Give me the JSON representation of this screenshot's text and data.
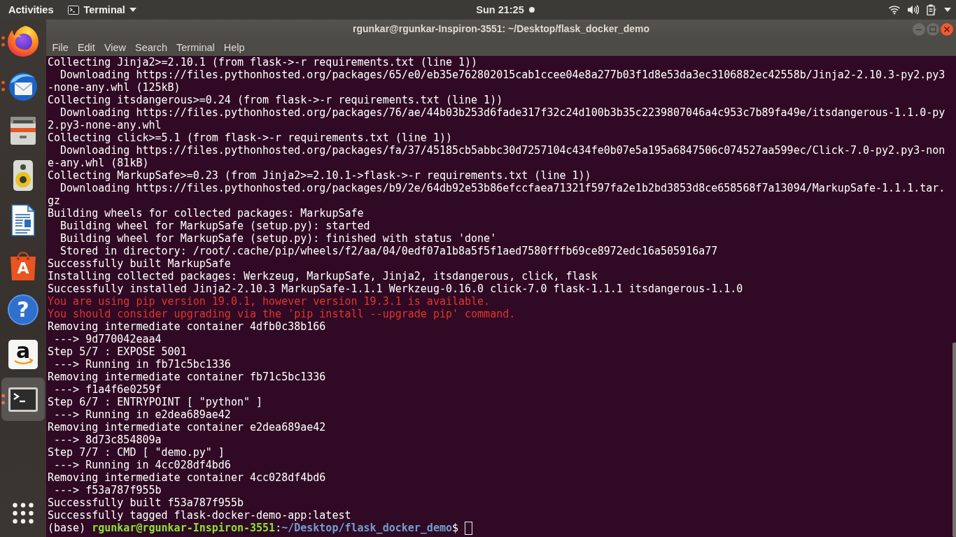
{
  "top_bar": {
    "activities": "Activities",
    "app_menu": "Terminal",
    "clock": "Sun 21:25",
    "notification": true
  },
  "dock": {
    "items": [
      {
        "kind": "browser",
        "running": true,
        "selected": false
      },
      {
        "kind": "mail",
        "running": true,
        "selected": false
      },
      {
        "kind": "files",
        "running": false,
        "selected": false
      },
      {
        "kind": "music",
        "running": false,
        "selected": false
      },
      {
        "kind": "writer",
        "running": false,
        "selected": false
      },
      {
        "kind": "software",
        "glyph": "A",
        "running": false,
        "selected": false
      },
      {
        "kind": "help",
        "glyph": "?",
        "running": false,
        "selected": false
      },
      {
        "kind": "store",
        "glyph": "a",
        "running": false,
        "selected": false
      },
      {
        "kind": "terminal",
        "running": true,
        "selected": true
      }
    ]
  },
  "window": {
    "title": "rgunkar@rgunkar-Inspiron-3551: ~/Desktop/flask_docker_demo",
    "menu": [
      "File",
      "Edit",
      "View",
      "Search",
      "Terminal",
      "Help"
    ]
  },
  "terminal": {
    "cursor_focused": false,
    "lines": [
      {
        "kind": "output",
        "text": "Collecting Jinja2>=2.10.1 (from flask->-r requirements.txt (line 1))"
      },
      {
        "kind": "output",
        "text": "  Downloading https://files.pythonhosted.org/packages/65/e0/eb35e762802015cab1ccee04e8a277b03f1d8e53da3ec3106882ec42558b/Jinja2-2.10.3-py2.py3-none-any.whl (125kB)"
      },
      {
        "kind": "output",
        "text": "Collecting itsdangerous>=0.24 (from flask->-r requirements.txt (line 1))"
      },
      {
        "kind": "output",
        "text": "  Downloading https://files.pythonhosted.org/packages/76/ae/44b03b253d6fade317f32c24d100b3b35c2239807046a4c953c7b89fa49e/itsdangerous-1.1.0-py2.py3-none-any.whl"
      },
      {
        "kind": "output",
        "text": "Collecting click>=5.1 (from flask->-r requirements.txt (line 1))"
      },
      {
        "kind": "output",
        "text": "  Downloading https://files.pythonhosted.org/packages/fa/37/45185cb5abbc30d7257104c434fe0b07e5a195a6847506c074527aa599ec/Click-7.0-py2.py3-none-any.whl (81kB)"
      },
      {
        "kind": "output",
        "text": "Collecting MarkupSafe>=0.23 (from Jinja2>=2.10.1->flask->-r requirements.txt (line 1))"
      },
      {
        "kind": "output",
        "text": "  Downloading https://files.pythonhosted.org/packages/b9/2e/64db92e53b86efccfaea71321f597fa2e1b2bd3853d8ce658568f7a13094/MarkupSafe-1.1.1.tar.gz"
      },
      {
        "kind": "output",
        "text": "Building wheels for collected packages: MarkupSafe"
      },
      {
        "kind": "output",
        "text": "  Building wheel for MarkupSafe (setup.py): started"
      },
      {
        "kind": "output",
        "text": "  Building wheel for MarkupSafe (setup.py): finished with status 'done'"
      },
      {
        "kind": "output",
        "text": "  Stored in directory: /root/.cache/pip/wheels/f2/aa/04/0edf07a1b8a5f5f1aed7580fffb69ce8972edc16a505916a77"
      },
      {
        "kind": "output",
        "text": "Successfully built MarkupSafe"
      },
      {
        "kind": "output",
        "text": "Installing collected packages: Werkzeug, MarkupSafe, Jinja2, itsdangerous, click, flask"
      },
      {
        "kind": "output",
        "text": "Successfully installed Jinja2-2.10.3 MarkupSafe-1.1.1 Werkzeug-0.16.0 click-7.0 flask-1.1.1 itsdangerous-1.1.0"
      },
      {
        "kind": "warning",
        "text": "You are using pip version 19.0.1, however version 19.3.1 is available."
      },
      {
        "kind": "warning",
        "text": "You should consider upgrading via the 'pip install --upgrade pip' command."
      },
      {
        "kind": "output",
        "text": "Removing intermediate container 4dfb0c38b166"
      },
      {
        "kind": "output",
        "text": " ---> 9d770042eaa4"
      },
      {
        "kind": "output",
        "text": "Step 5/7 : EXPOSE 5001"
      },
      {
        "kind": "output",
        "text": " ---> Running in fb71c5bc1336"
      },
      {
        "kind": "output",
        "text": "Removing intermediate container fb71c5bc1336"
      },
      {
        "kind": "output",
        "text": " ---> f1a4f6e0259f"
      },
      {
        "kind": "output",
        "text": "Step 6/7 : ENTRYPOINT [ \"python\" ]"
      },
      {
        "kind": "output",
        "text": " ---> Running in e2dea689ae42"
      },
      {
        "kind": "output",
        "text": "Removing intermediate container e2dea689ae42"
      },
      {
        "kind": "output",
        "text": " ---> 8d73c854809a"
      },
      {
        "kind": "output",
        "text": "Step 7/7 : CMD [ \"demo.py\" ]"
      },
      {
        "kind": "output",
        "text": " ---> Running in 4cc028df4bd6"
      },
      {
        "kind": "output",
        "text": "Removing intermediate container 4cc028df4bd6"
      },
      {
        "kind": "output",
        "text": " ---> f53a787f955b"
      },
      {
        "kind": "output",
        "text": "Successfully built f53a787f955b"
      },
      {
        "kind": "output",
        "text": "Successfully tagged flask-docker-demo-app:latest"
      },
      {
        "kind": "prompt",
        "env": "(base)",
        "user_host": "rgunkar@rgunkar-Inspiron-3551",
        "separator": ":",
        "path": "~/Desktop/flask_docker_demo",
        "symbol": "$"
      }
    ]
  }
}
